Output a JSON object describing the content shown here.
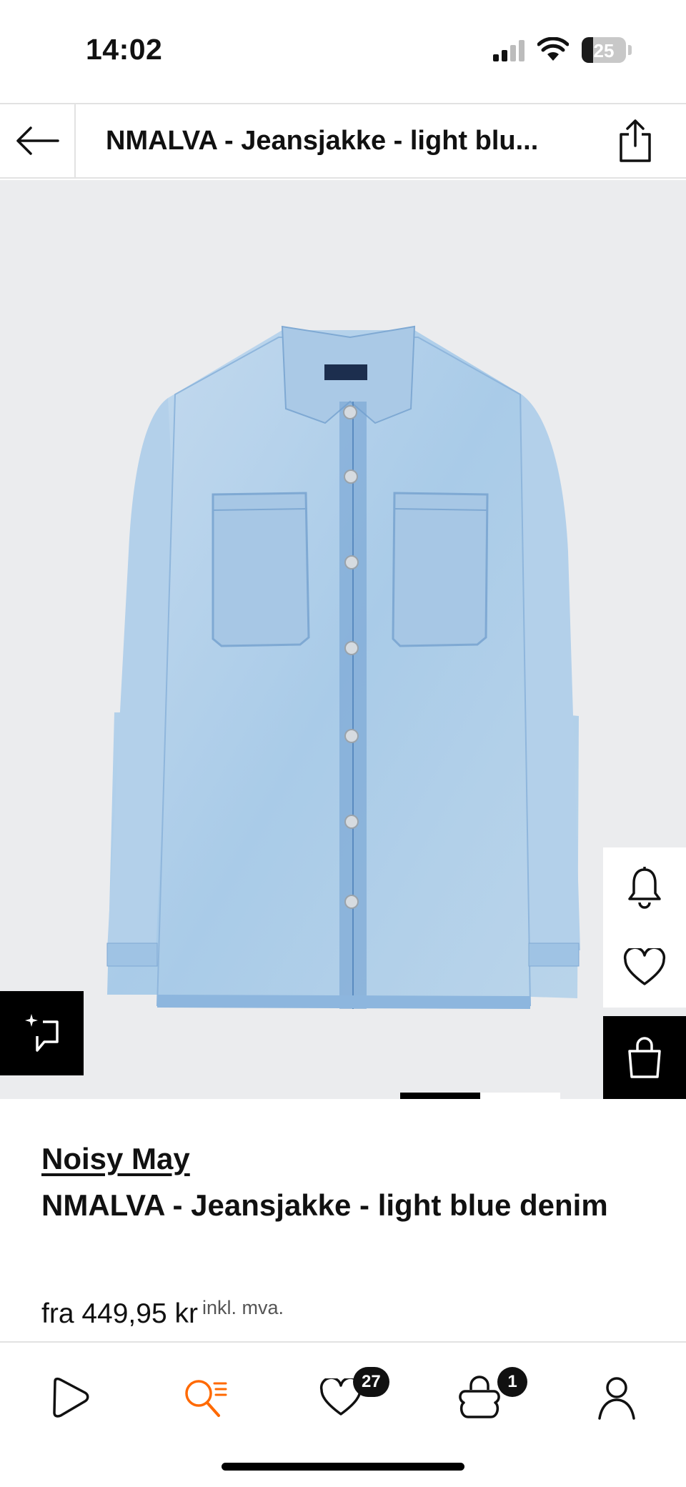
{
  "status_bar": {
    "time": "14:02",
    "battery": "25",
    "battery_level": 0.25
  },
  "header": {
    "title": "NMALVA  - Jeansjakke - light blu..."
  },
  "gallery": {
    "active_page": 1,
    "total_pages": 2
  },
  "product": {
    "brand": "Noisy May",
    "name": "NMALVA  - Jeansjakke - light blue denim",
    "price": "fra 449,95 kr",
    "vat_note": "inkl. mva."
  },
  "side_actions": [
    "bell-icon",
    "heart-icon",
    "bag-icon"
  ],
  "tabbar": {
    "tabs": [
      "home-icon",
      "search-icon",
      "wishlist-icon",
      "cart-icon",
      "profile-icon"
    ],
    "active_color": "#ff6900",
    "wishlist_count": "27",
    "cart_count": "1"
  }
}
